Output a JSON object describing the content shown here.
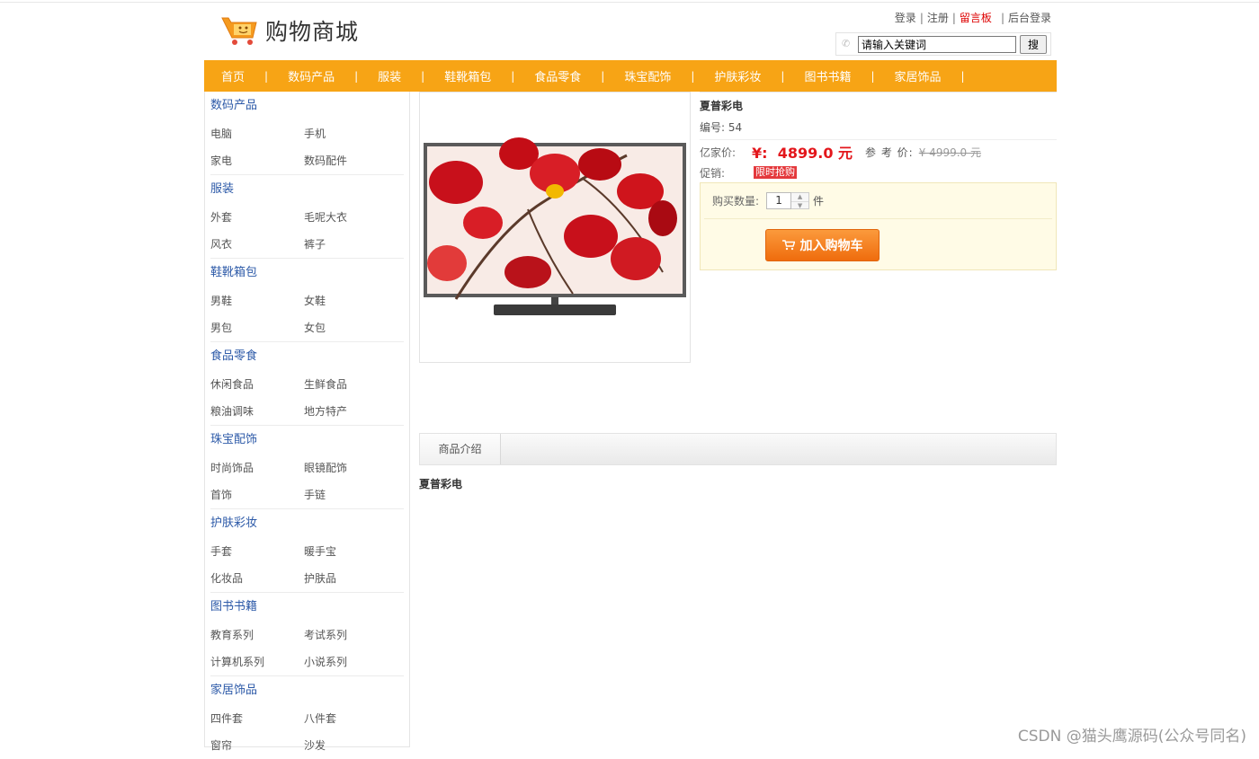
{
  "header": {
    "logo_text": "购物商城",
    "links": [
      "登录",
      "注册",
      "留言板",
      "后台登录"
    ],
    "search_placeholder": "请输入关键词",
    "search_value": "请输入关键词",
    "search_button": "搜"
  },
  "nav": [
    "首页",
    "数码产品",
    "服装",
    "鞋靴箱包",
    "食品零食",
    "珠宝配饰",
    "护肤彩妆",
    "图书书籍",
    "家居饰品"
  ],
  "nav_separator": "|",
  "sidebar": [
    {
      "title": "数码产品",
      "items": [
        [
          "电脑",
          "手机"
        ],
        [
          "家电",
          "数码配件"
        ]
      ]
    },
    {
      "title": "服装",
      "items": [
        [
          "外套",
          "毛呢大衣"
        ],
        [
          "风衣",
          "裤子"
        ]
      ]
    },
    {
      "title": "鞋靴箱包",
      "items": [
        [
          "男鞋",
          "女鞋"
        ],
        [
          "男包",
          "女包"
        ]
      ]
    },
    {
      "title": "食品零食",
      "items": [
        [
          "休闲食品",
          "生鲜食品"
        ],
        [
          "粮油调味",
          "地方特产"
        ]
      ]
    },
    {
      "title": "珠宝配饰",
      "items": [
        [
          "时尚饰品",
          "眼镜配饰"
        ],
        [
          "首饰",
          "手链"
        ]
      ]
    },
    {
      "title": "护肤彩妆",
      "items": [
        [
          "手套",
          "暖手宝"
        ],
        [
          "化妆品",
          "护肤品"
        ]
      ]
    },
    {
      "title": "图书书籍",
      "items": [
        [
          "教育系列",
          "考试系列"
        ],
        [
          "计算机系列",
          "小说系列"
        ]
      ]
    },
    {
      "title": "家居饰品",
      "items": [
        [
          "四件套",
          "八件套"
        ],
        [
          "窗帘",
          "沙发"
        ]
      ]
    }
  ],
  "product": {
    "name": "夏普彩电",
    "code_label": "编号:",
    "code": "54",
    "price_label": "亿家价:",
    "price": "¥:  4899.0 元",
    "ref_label": "参 考 价:",
    "ref_price": "¥ 4999.0 元",
    "promo_label": "促销:",
    "promo_badge": "限时抢购",
    "qty_label": "购买数量:",
    "qty": "1",
    "unit": "件",
    "add_cart": "加入购物车"
  },
  "tabs": {
    "intro": "商品介绍"
  },
  "description": "夏普彩电",
  "watermark": "CSDN @猫头鹰源码(公众号同名)",
  "colors": {
    "nav": "#f7a415",
    "price": "#e3161b",
    "link_blue": "#2d5aa8",
    "cart_button": "#f57d1f"
  },
  "icons": [
    "shopping-cart-logo-icon",
    "phone-icon",
    "cart-icon",
    "stepper-up-icon",
    "stepper-down-icon"
  ]
}
